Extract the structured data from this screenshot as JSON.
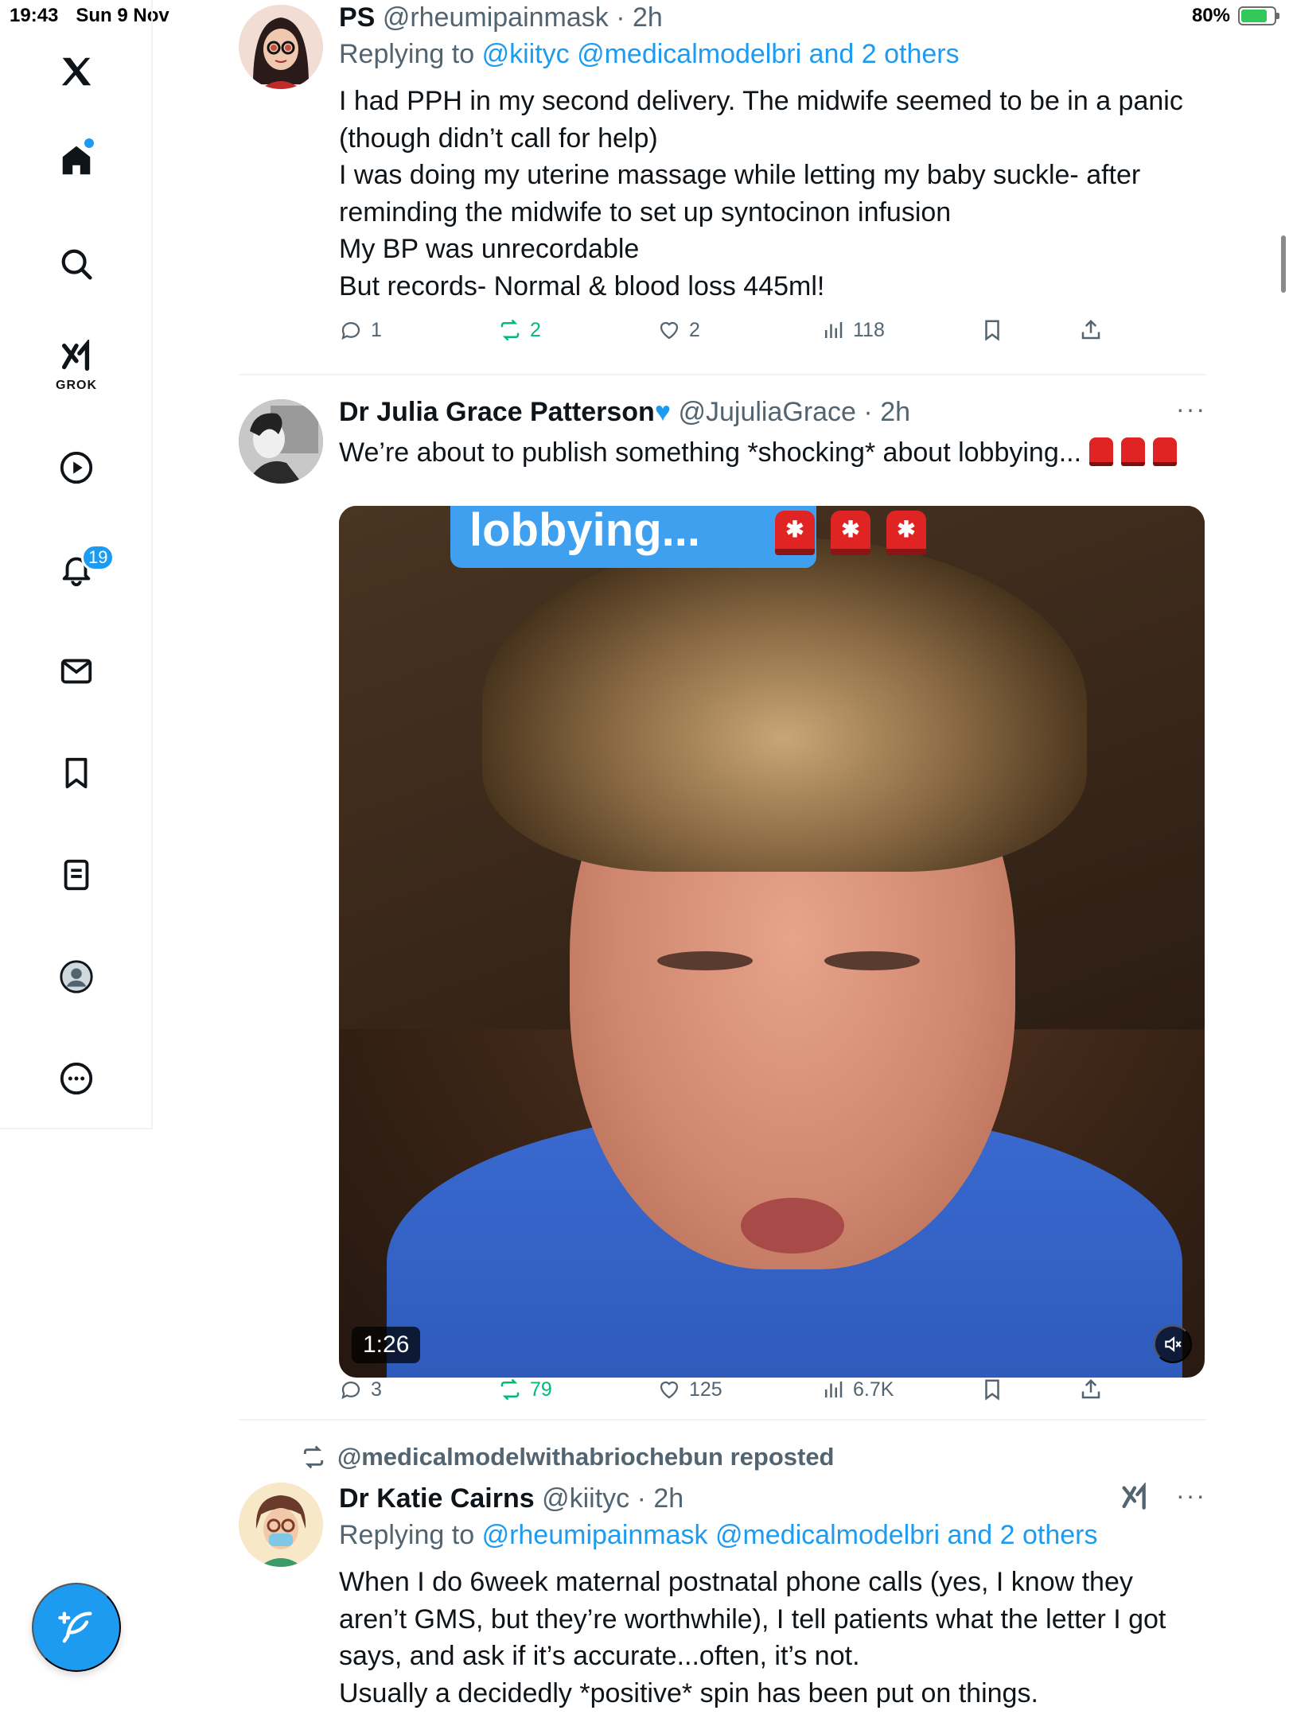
{
  "status_bar": {
    "time": "19:43",
    "date": "Sun 9 Nov",
    "battery": "80%",
    "battery_level": 0.8
  },
  "sidebar": {
    "items": [
      "x-logo",
      "home",
      "search",
      "grok",
      "video",
      "notifications",
      "messages",
      "bookmarks",
      "lists",
      "profile",
      "more"
    ],
    "grok_label": "GROK",
    "notification_count": "19"
  },
  "tweets": [
    {
      "name": "PS",
      "handle": "@rheumipainmask",
      "time": "2h",
      "replying_label": "Replying to",
      "replying_to": "@kiityc @medicalmodelbri and 2 others",
      "lines": [
        "I had PPH in my second delivery. The midwife seemed to be in a panic",
        "(though didn’t call for help)",
        "I was doing my uterine massage while letting my baby suckle- after",
        "reminding the midwife to set up syntocinon infusion",
        "My BP was unrecordable",
        "But records- Normal & blood loss 445ml!"
      ],
      "replies": "1",
      "reposts": "2",
      "likes": "2",
      "views": "118"
    },
    {
      "name": "Dr Julia Grace Patterson",
      "handle": "@JujuliaGrace",
      "time": "2h",
      "text": "We’re about to publish something *shocking* about lobbying...",
      "video": {
        "caption": "lobbying...",
        "duration": "1:26"
      },
      "replies": "3",
      "reposts": "79",
      "likes": "125",
      "views": "6.7K"
    },
    {
      "repost_by": "@medicalmodelwithabriochebun reposted",
      "name": "Dr Katie Cairns",
      "handle": "@kiityc",
      "time": "2h",
      "replying_label": "Replying to",
      "replying_to": "@rheumipainmask @medicalmodelbri and 2 others",
      "lines": [
        "When I do 6week maternal postnatal phone calls (yes, I know they",
        "aren’t GMS, but they’re worthwhile), I tell patients what the letter I got",
        "says, and ask if it’s accurate...often, it’s not.",
        "Usually a decidedly *positive* spin has been put on things."
      ]
    }
  ],
  "colors": {
    "accent": "#1d9bf0",
    "repost": "#00ba7c",
    "muted": "#536471"
  }
}
